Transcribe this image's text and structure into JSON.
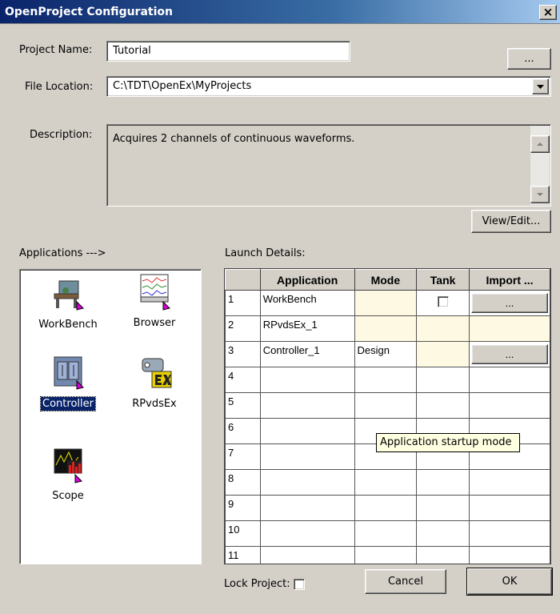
{
  "window": {
    "title": "OpenProject Configuration",
    "close_glyph": "×"
  },
  "project_name": {
    "label": "Project Name:",
    "value": "Tutorial",
    "browse_label": "..."
  },
  "file_location": {
    "label": "File Location:",
    "value": "C:\\TDT\\OpenEx\\MyProjects"
  },
  "description": {
    "label": "Description:",
    "value": "Acquires 2 channels of continuous waveforms.",
    "view_edit_label": "View/Edit..."
  },
  "applications": {
    "label": "Applications --->",
    "items": [
      {
        "label": "WorkBench",
        "icon": "workbench-icon",
        "selected": false
      },
      {
        "label": "Browser",
        "icon": "browser-icon",
        "selected": false
      },
      {
        "label": "Controller",
        "icon": "controller-icon",
        "selected": true
      },
      {
        "label": "RPvdsEx",
        "icon": "rpvdsex-icon",
        "selected": false
      },
      {
        "label": "Scope",
        "icon": "scope-icon",
        "selected": false
      }
    ]
  },
  "launch_details": {
    "label": "Launch Details:",
    "columns": [
      "",
      "Application",
      "Mode",
      "Tank",
      "Import ..."
    ],
    "rows": [
      {
        "num": "1",
        "application": "WorkBench",
        "mode": "",
        "tank_checkbox": true,
        "import_button": "..."
      },
      {
        "num": "2",
        "application": "RPvdsEx_1",
        "mode": "",
        "tank_checkbox": false,
        "import_button": ""
      },
      {
        "num": "3",
        "application": "Controller_1",
        "mode": "Design",
        "tank_checkbox": false,
        "import_button": "..."
      },
      {
        "num": "4",
        "application": "",
        "mode": ""
      },
      {
        "num": "5",
        "application": "",
        "mode": ""
      },
      {
        "num": "6",
        "application": "",
        "mode": ""
      },
      {
        "num": "7",
        "application": "",
        "mode": ""
      },
      {
        "num": "8",
        "application": "",
        "mode": ""
      },
      {
        "num": "9",
        "application": "",
        "mode": ""
      },
      {
        "num": "10",
        "application": "",
        "mode": ""
      },
      {
        "num": "11",
        "application": "",
        "mode": ""
      }
    ],
    "tooltip": "Application startup mode"
  },
  "lock_project": {
    "label": "Lock Project:",
    "checked": false
  },
  "buttons": {
    "cancel": "Cancel",
    "ok": "OK"
  },
  "colors": {
    "titlebar": "#0a246a",
    "face": "#d4d0c8",
    "cell_highlight": "#fdf9e2",
    "selection": "#0a246a"
  }
}
